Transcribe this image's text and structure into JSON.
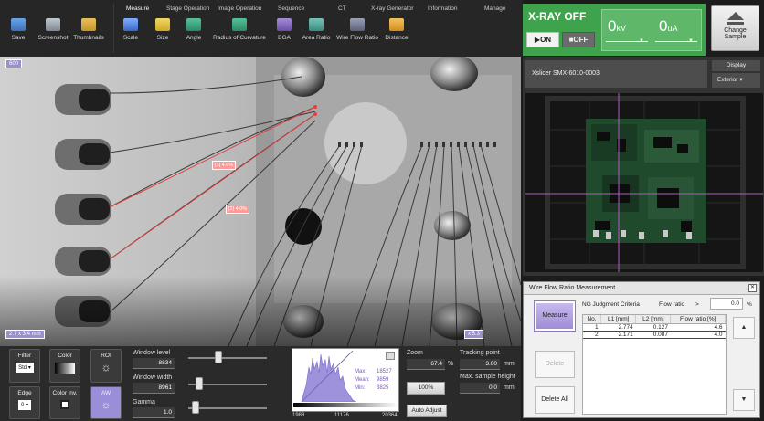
{
  "toolbar": {
    "tabs": [
      "Measure",
      "Stage Operation",
      "Image Operation",
      "Sequence",
      "CT",
      "X-ray Generator",
      "Information",
      "Manage"
    ],
    "buttons": [
      "Save",
      "Screenshot",
      "Thumbnails",
      "Scale",
      "Size",
      "Angle",
      "Radius of Curvature",
      "BGA",
      "Area Ratio",
      "Wire Flow Ratio",
      "Distance"
    ]
  },
  "xray": {
    "status": "X-RAY OFF",
    "on_label": "▶ON",
    "off_label": "■OFF",
    "kv_value": "0",
    "kv_unit": "kV",
    "ua_value": "0",
    "ua_unit": "uA",
    "accent_color": "#3fa34d"
  },
  "change_sample": {
    "line1": "Change",
    "line2": "Sample"
  },
  "image": {
    "top_left_tag": "600",
    "bottom_left_tag": "2.7 x 3.4 mm",
    "bottom_right_tag": "x 5.3",
    "ratio_labels": [
      "[1] 4.6%",
      "[2] 4.0%"
    ]
  },
  "controls": {
    "filter_label": "Filter",
    "filter_value": "Std",
    "color_label": "Color",
    "roi_label": "ROI",
    "edge_label": "Edge",
    "edge_value": "0",
    "color_inv_label": "Color inv.",
    "aw_label": "AW",
    "window_level_label": "Window level",
    "window_level_value": "8834",
    "window_width_label": "Window width",
    "window_width_value": "8961",
    "gamma_label": "Gamma",
    "gamma_value": "1.0",
    "window_level_fraction": 0.37,
    "window_width_fraction": 0.1,
    "gamma_fraction": 0.05
  },
  "histogram": {
    "max_label": "Max:",
    "max_value": "18527",
    "mean_label": "Mean:",
    "mean_value": "9859",
    "min_label": "Min:",
    "min_value": "3825",
    "axis_min": "1988",
    "axis_mid": "11176",
    "axis_max": "20364"
  },
  "zoom": {
    "label": "Zoom",
    "value": "67.4",
    "unit": "%",
    "reset_label": "100%",
    "auto_adjust_label": "Auto Adjust"
  },
  "tracking": {
    "label": "Tracking point",
    "value": "3.00",
    "unit": "mm",
    "max_height_label": "Max. sample height",
    "max_height_value": "0.0",
    "max_height_unit": "mm"
  },
  "camera": {
    "title": "Xslicer SMX-6010-0003",
    "display_label": "Display",
    "display_value": "Exterior"
  },
  "wfr": {
    "title": "Wire Flow Ratio Measurement",
    "measure_label": "Measure",
    "delete_label": "Delete",
    "delete_all_label": "Delete All",
    "ng_label": "NG Judgment Criteria :",
    "ng_metric": "Flow ratio",
    "ng_operator": ">",
    "ng_value": "0.0",
    "ng_unit": "%",
    "columns": [
      "No.",
      "L1 [mm]",
      "L2 [mm]",
      "Flow ratio [%]"
    ],
    "rows": [
      [
        "1",
        "2.774",
        "0.127",
        "4.6"
      ],
      [
        "2",
        "2.171",
        "0.087",
        "4.0"
      ]
    ]
  }
}
